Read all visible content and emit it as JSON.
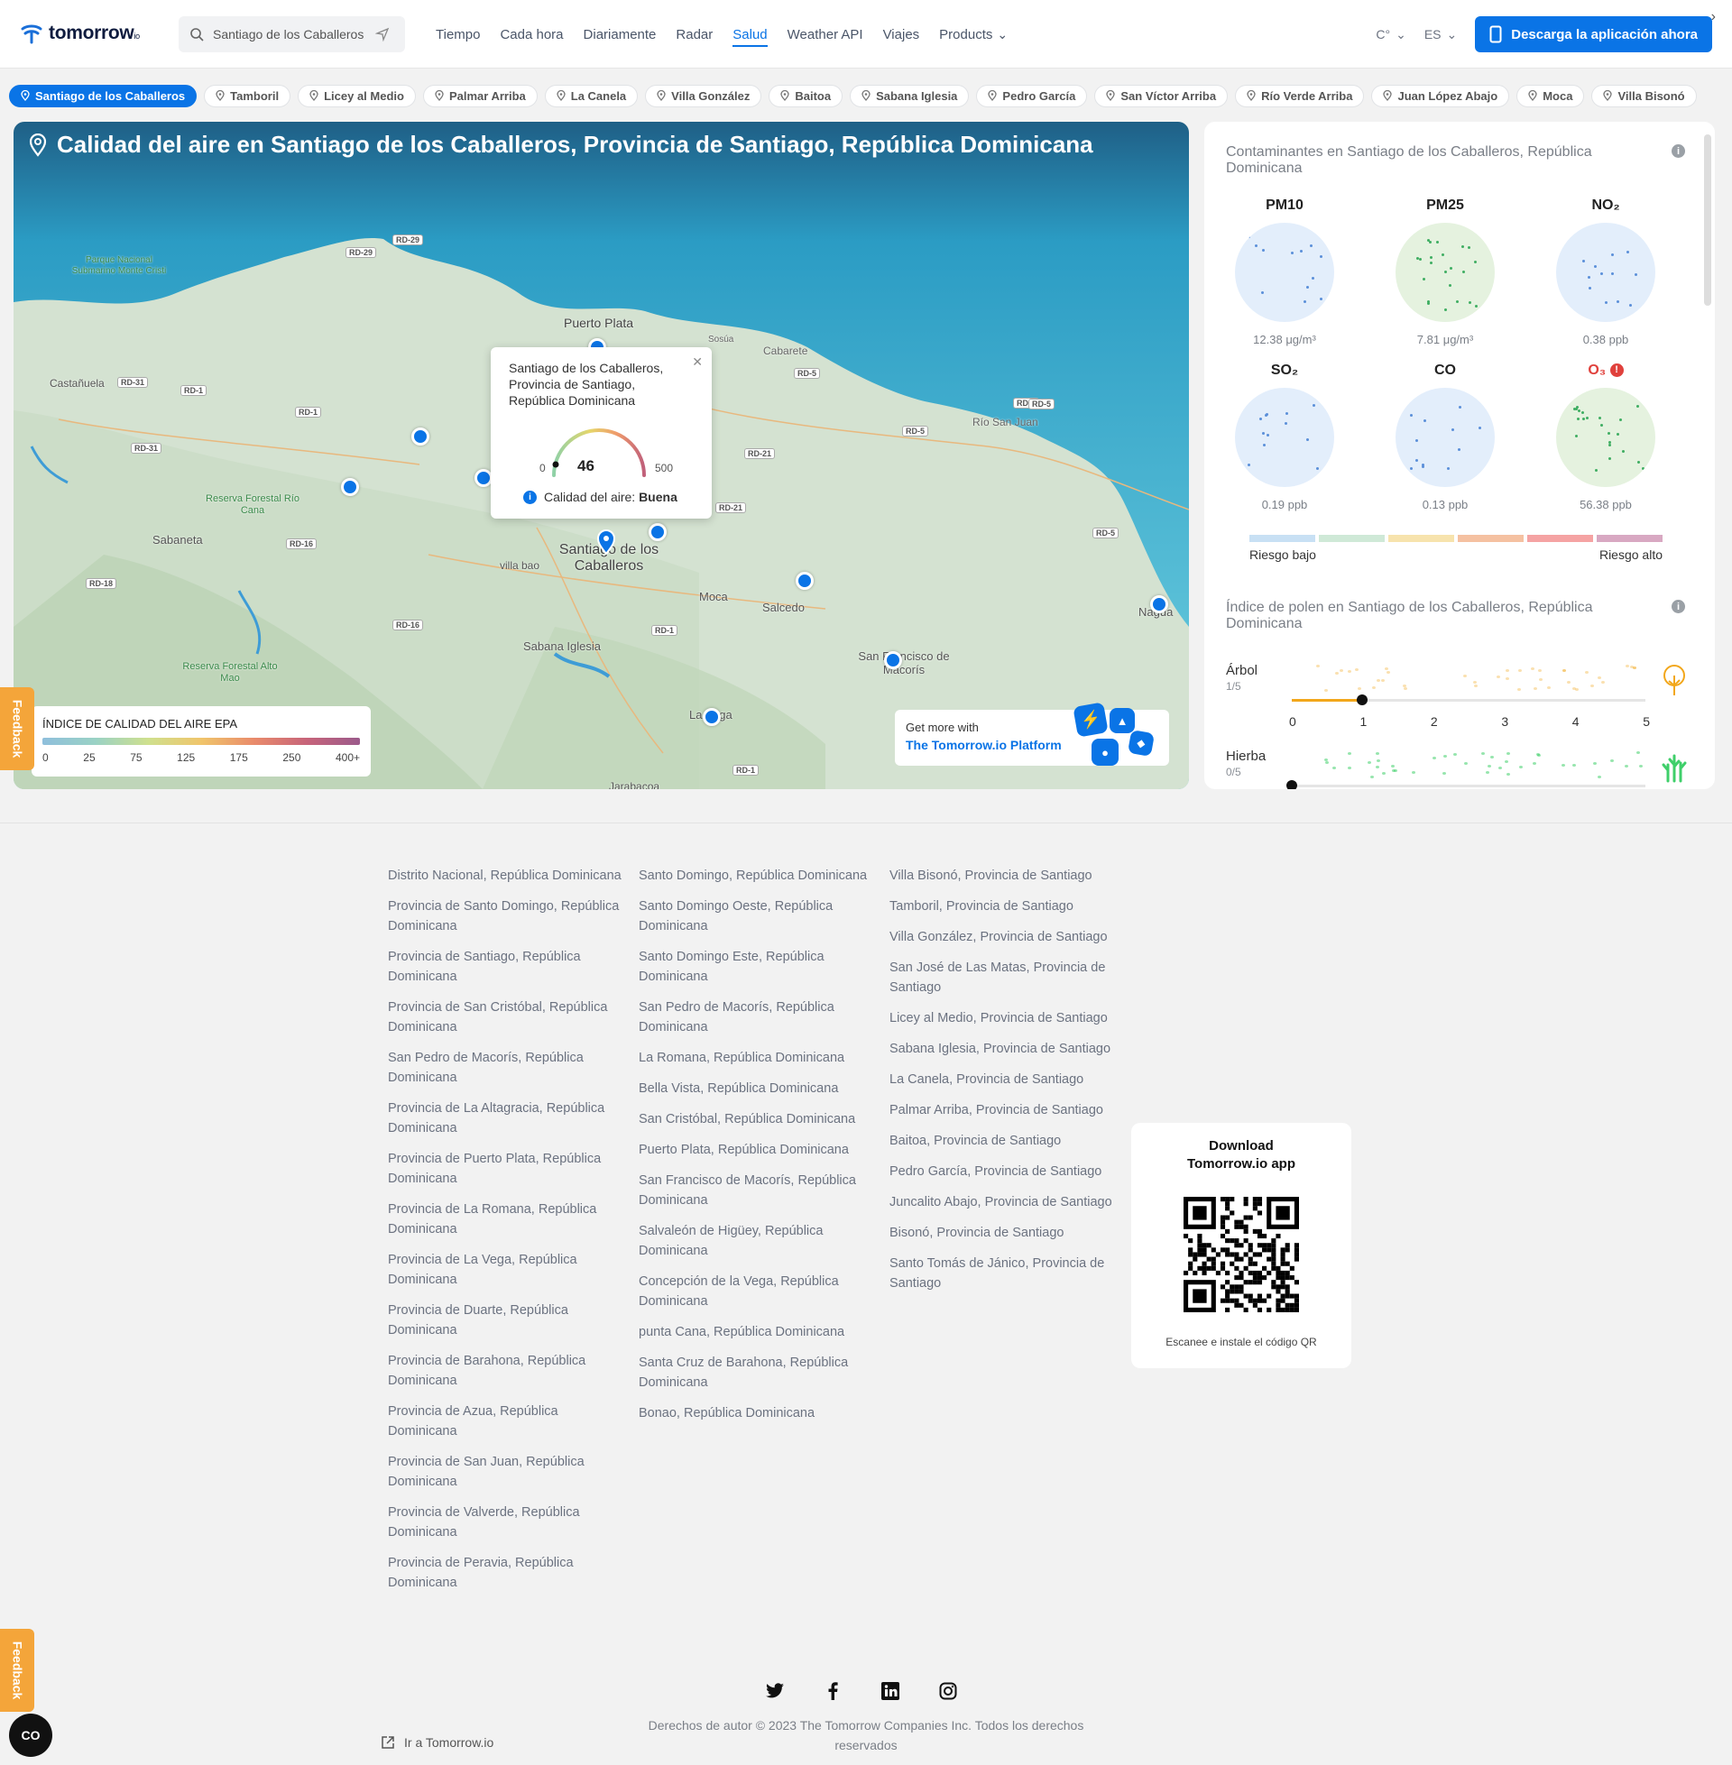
{
  "header": {
    "logo_text": "tomorrow",
    "logo_suffix": "io",
    "search_value": "Santiago de los Caballeros",
    "nav": [
      "Tiempo",
      "Cada hora",
      "Diariamente",
      "Radar",
      "Salud",
      "Weather API",
      "Viajes",
      "Products"
    ],
    "active_nav": "Salud",
    "unit": "C°",
    "lang": "ES",
    "download_label": "Descarga la aplicación ahora"
  },
  "chips": [
    "Santiago de los Caballeros",
    "Tamboril",
    "Licey al Medio",
    "Palmar Arriba",
    "La Canela",
    "Villa González",
    "Baitoa",
    "Sabana Iglesia",
    "Pedro García",
    "San Víctor Arriba",
    "Río Verde Arriba",
    "Juan López Abajo",
    "Moca",
    "Villa Bisonó"
  ],
  "map": {
    "title": "Calidad del aire en Santiago de los Caballeros, Provincia de Santiago, República Dominicana",
    "labels": [
      {
        "text": "Parque Nacional Submarino Monte Cristi",
        "c": "#3a8a4a"
      },
      {
        "text": "Puerto Plata",
        "c": "#444"
      },
      {
        "text": "Sosúa",
        "c": "#666"
      },
      {
        "text": "Cabarete",
        "c": "#666"
      },
      {
        "text": "Castañuela",
        "c": "#555"
      },
      {
        "text": "Río San Juan",
        "c": "#666"
      },
      {
        "text": "Reserva Forestal Río Cana",
        "c": "#3a8a4a"
      },
      {
        "text": "Sabaneta",
        "c": "#555"
      },
      {
        "text": "Santiago de los Caballeros",
        "c": "#444"
      },
      {
        "text": "villa bao",
        "c": "#555"
      },
      {
        "text": "Moca",
        "c": "#555"
      },
      {
        "text": "Salcedo",
        "c": "#555"
      },
      {
        "text": "Nagua",
        "c": "#555"
      },
      {
        "text": "Sabana Iglesia",
        "c": "#555"
      },
      {
        "text": "Reserva Forestal Alto Mao",
        "c": "#3a8a4a"
      },
      {
        "text": "San Francisco de Macorís",
        "c": "#555"
      },
      {
        "text": "La Vega",
        "c": "#555"
      },
      {
        "text": "Jarabacoa",
        "c": "#555"
      }
    ],
    "road_labels": [
      "RD-29",
      "RD-29",
      "RD-31",
      "RD-1",
      "RD-1",
      "RD-31",
      "RD-5",
      "RD-5",
      "RD-5",
      "RD-21",
      "RD-21",
      "RD-16",
      "RD-18",
      "RD-16",
      "RD-1",
      "RD-1",
      "RD-5",
      "RD-5"
    ],
    "popup": {
      "place": "Santiago de los Caballeros,  Provincia de Santiago, República Dominicana",
      "aqi": "46",
      "min": "0",
      "max": "500",
      "quality_label": "Calidad del aire:",
      "quality_value": "Buena"
    },
    "legend": {
      "title": "ÍNDICE DE CALIDAD DEL AIRE EPA",
      "ticks": [
        "0",
        "25",
        "75",
        "125",
        "175",
        "250",
        "400+"
      ]
    },
    "promo": {
      "line1": "Get more with",
      "line2": "The Tomorrow.io Platform"
    },
    "feedback": "Feedback"
  },
  "pollutants": {
    "title": "Contaminantes en Santiago de los Caballeros, República Dominicana",
    "items": [
      {
        "name": "PM10",
        "value": "12.38 μg/m³",
        "bg": "#e3eefb",
        "dot": "#5b8fd9",
        "alert": false
      },
      {
        "name": "PM25",
        "value": "7.81 μg/m³",
        "bg": "#e5f2df",
        "dot": "#3fae62",
        "alert": false
      },
      {
        "name": "NO₂",
        "value": "0.38 ppb",
        "bg": "#e3eefb",
        "dot": "#5b8fd9",
        "alert": false
      },
      {
        "name": "SO₂",
        "value": "0.19 ppb",
        "bg": "#e3eefb",
        "dot": "#5b8fd9",
        "alert": false
      },
      {
        "name": "CO",
        "value": "0.13 ppb",
        "bg": "#e3eefb",
        "dot": "#5b8fd9",
        "alert": false
      },
      {
        "name": "O₃",
        "value": "56.38 ppb",
        "bg": "#e5f2df",
        "dot": "#3fae62",
        "alert": true
      }
    ],
    "risk_low": "Riesgo bajo",
    "risk_high": "Riesgo alto",
    "risk_colors": [
      "#c8e0f4",
      "#cfe9d7",
      "#f7e3ad",
      "#f5c1a1",
      "#f5a3a3",
      "#d8a8c2"
    ]
  },
  "pollen": {
    "title": "Índice de polen en Santiago de los Caballeros, República Dominicana",
    "rows": [
      {
        "name": "Árbol",
        "score": "1/5",
        "level": 1,
        "color": "#f2a71b"
      },
      {
        "name": "Hierba",
        "score": "0/5",
        "level": 0,
        "color": "#3fcf6a"
      }
    ],
    "scale": [
      "0",
      "1",
      "2",
      "3",
      "4",
      "5"
    ]
  },
  "footer": {
    "col1": [
      "Distrito Nacional, República Dominicana",
      "Provincia de Santo Domingo, República Dominicana",
      "Provincia de Santiago, República Dominicana",
      "Provincia de San Cristóbal, República Dominicana",
      "San Pedro de Macorís, República Dominicana",
      "Provincia de La Altagracia, República Dominicana",
      "Provincia de Puerto Plata, República Dominicana",
      "Provincia de La Romana, República Dominicana",
      "Provincia de La Vega, República Dominicana",
      "Provincia de Duarte, República Dominicana",
      "Provincia de Barahona, República Dominicana",
      "Provincia de Azua, República Dominicana",
      "Provincia de San Juan, República Dominicana",
      "Provincia de Valverde, República Dominicana",
      "Provincia de Peravia, República Dominicana"
    ],
    "col2": [
      "Santo Domingo, República Dominicana",
      "Santo Domingo Oeste, República Dominicana",
      "Santo Domingo Este, República Dominicana",
      "San Pedro de Macorís, República Dominicana",
      "La Romana, República Dominicana",
      "Bella Vista, República Dominicana",
      "San Cristóbal, República Dominicana",
      "Puerto Plata, República Dominicana",
      "San Francisco de Macorís, República Dominicana",
      "Salvaleón de Higüey, República Dominicana",
      "Concepción de la Vega, República Dominicana",
      "punta Cana, República Dominicana",
      "Santa Cruz de Barahona, República Dominicana",
      "Bonao, República Dominicana"
    ],
    "col3": [
      "Villa Bisonó, Provincia de Santiago",
      "Tamboril, Provincia de Santiago",
      "Villa González, Provincia de Santiago",
      "San José de Las Matas, Provincia de Santiago",
      "Licey al Medio, Provincia de Santiago",
      "Sabana Iglesia, Provincia de Santiago",
      "La Canela, Provincia de Santiago",
      "Palmar Arriba, Provincia de Santiago",
      "Baitoa, Provincia de Santiago",
      "Pedro García, Provincia de Santiago",
      "Juncalito Abajo, Provincia de Santiago",
      "Bisonó, Provincia de Santiago",
      "Santo Tomás de Jánico, Provincia de Santiago"
    ],
    "qr_title": "Download Tomorrow.io app",
    "qr_sub": "Escanee e instale el código QR",
    "social": [
      "twitter-icon",
      "facebook-icon",
      "linkedin-icon",
      "instagram-icon"
    ],
    "copyright": "Derechos de autor © 2023 The Tomorrow Companies Inc. Todos los derechos reservados",
    "goto": "Ir a Tomorrow.io",
    "feedback": "Feedback",
    "cookie": "CO"
  }
}
